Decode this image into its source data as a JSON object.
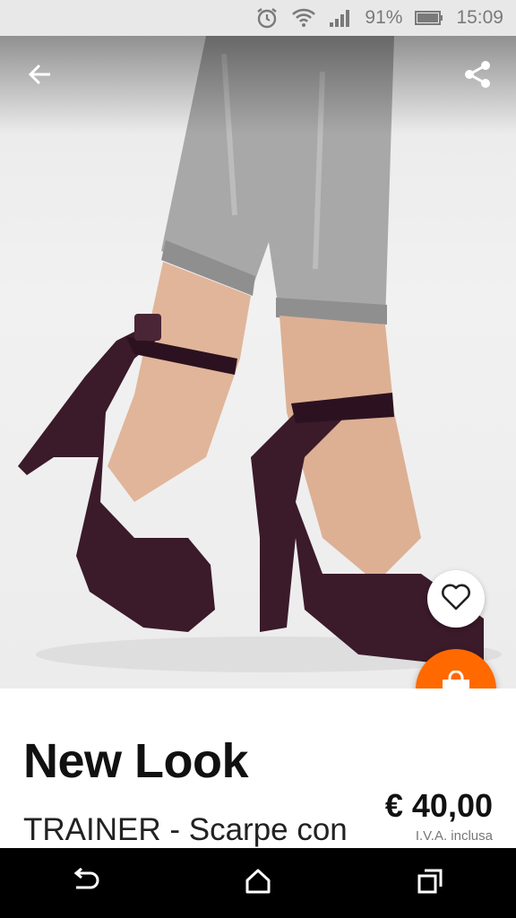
{
  "status_bar": {
    "icons": [
      "alarm-icon",
      "wifi-icon",
      "signal-icon",
      "battery-icon"
    ],
    "battery": "91%",
    "time": "15:09"
  },
  "header": {
    "back_icon": "arrow-left-icon",
    "share_icon": "share-icon"
  },
  "product": {
    "brand": "New Look",
    "name": "TRAINER - Scarpe con",
    "price": "€ 40,00",
    "vat_note": "I.V.A. inclusa"
  },
  "actions": {
    "wishlist_icon": "heart-icon",
    "cart_icon": "shopping-bag-icon"
  },
  "colors": {
    "accent": "#ff6900",
    "shoe": "#3b1a2a"
  },
  "nav_bar": {
    "icons": [
      "back-icon",
      "home-icon",
      "recents-icon"
    ]
  }
}
